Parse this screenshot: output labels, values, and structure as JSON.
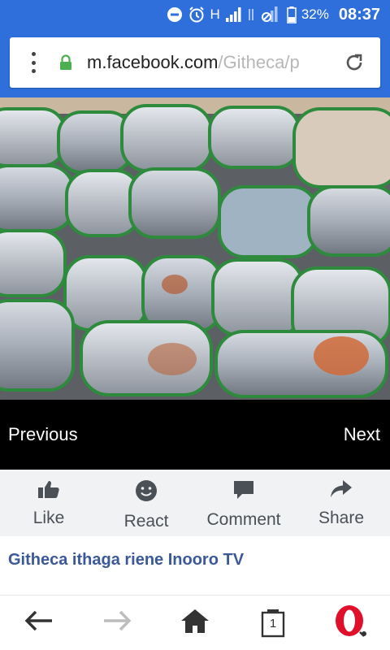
{
  "status_bar": {
    "network": "H",
    "battery": "32%",
    "time": "08:37"
  },
  "browser": {
    "url_host": "m.facebook.com",
    "url_path": "/Githeca/p"
  },
  "photo_viewer": {
    "previous_label": "Previous",
    "next_label": "Next"
  },
  "actions": [
    {
      "label": "Like",
      "icon": "thumbs-up-icon"
    },
    {
      "label": "React",
      "icon": "smiley-icon"
    },
    {
      "label": "Comment",
      "icon": "comment-icon"
    },
    {
      "label": "Share",
      "icon": "share-icon"
    }
  ],
  "caption": "Githeca ithaga riene Inooro TV",
  "bottom_nav": {
    "tab_count": "1",
    "icons": [
      "back-arrow-icon",
      "forward-arrow-icon",
      "home-icon",
      "tabs-icon",
      "opera-icon"
    ]
  },
  "colors": {
    "status_bar": "#2f6fdc",
    "link": "#3b5998",
    "opera_red": "#e0102a",
    "secure_lock": "#4caf50"
  }
}
